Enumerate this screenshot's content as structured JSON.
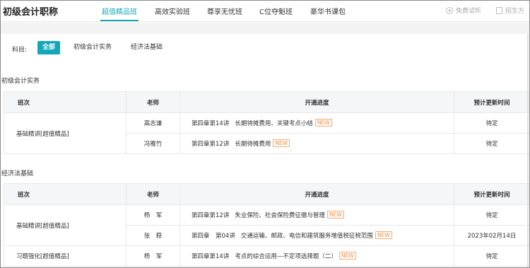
{
  "header": {
    "brand": "初级会计职称",
    "tabs": [
      {
        "label": "超值精品班",
        "active": true
      },
      {
        "label": "高效实验班",
        "active": false
      },
      {
        "label": "尊享无忧班",
        "active": false
      },
      {
        "label": "C位夺魁班",
        "active": false
      },
      {
        "label": "豪华书课包",
        "active": false
      }
    ],
    "free_trial": "免费试听",
    "enroll": "招生方"
  },
  "filter": {
    "label": "科目:",
    "options": [
      {
        "label": "全部",
        "active": true
      },
      {
        "label": "初级会计实务",
        "active": false
      },
      {
        "label": "经济法基础",
        "active": false
      }
    ]
  },
  "columns": {
    "class": "班次",
    "teacher": "老师",
    "progress": "开通进度",
    "time": "预计更新时间"
  },
  "new_label": "NEW",
  "sections": [
    {
      "title": "初级会计实务",
      "rows": [
        {
          "class": "基础精讲[超值精品]",
          "teacher": "高志谦",
          "chapter": "第四章第14讲",
          "topic": "长期待摊费用、关键考点小结",
          "is_new": true,
          "time": "待定"
        },
        {
          "class": "",
          "teacher": "冯雅竹",
          "chapter": "第四章第12讲",
          "topic": "长期待摊费用",
          "is_new": true,
          "time": "待定"
        }
      ]
    },
    {
      "title": "经济法基础",
      "rows": [
        {
          "class": "基础精讲[超值精品]",
          "teacher": "杨　军",
          "chapter": "第四章第12讲",
          "topic": "失业保险、社会保险费征缴与管理",
          "is_new": true,
          "time": "待定"
        },
        {
          "class": "",
          "teacher": "张　稳",
          "chapter": "第四章　第04讲",
          "topic": "交通运输、邮政、电信和建筑服务增值税征税范围",
          "is_new": true,
          "time": "2023年02月14日"
        },
        {
          "class": "习题强化[超值精品]",
          "teacher": "杨　军",
          "chapter": "第四章第14讲",
          "topic": "考点的综合运用—不定项选择题（二）",
          "is_new": true,
          "time": "待定"
        }
      ]
    }
  ]
}
